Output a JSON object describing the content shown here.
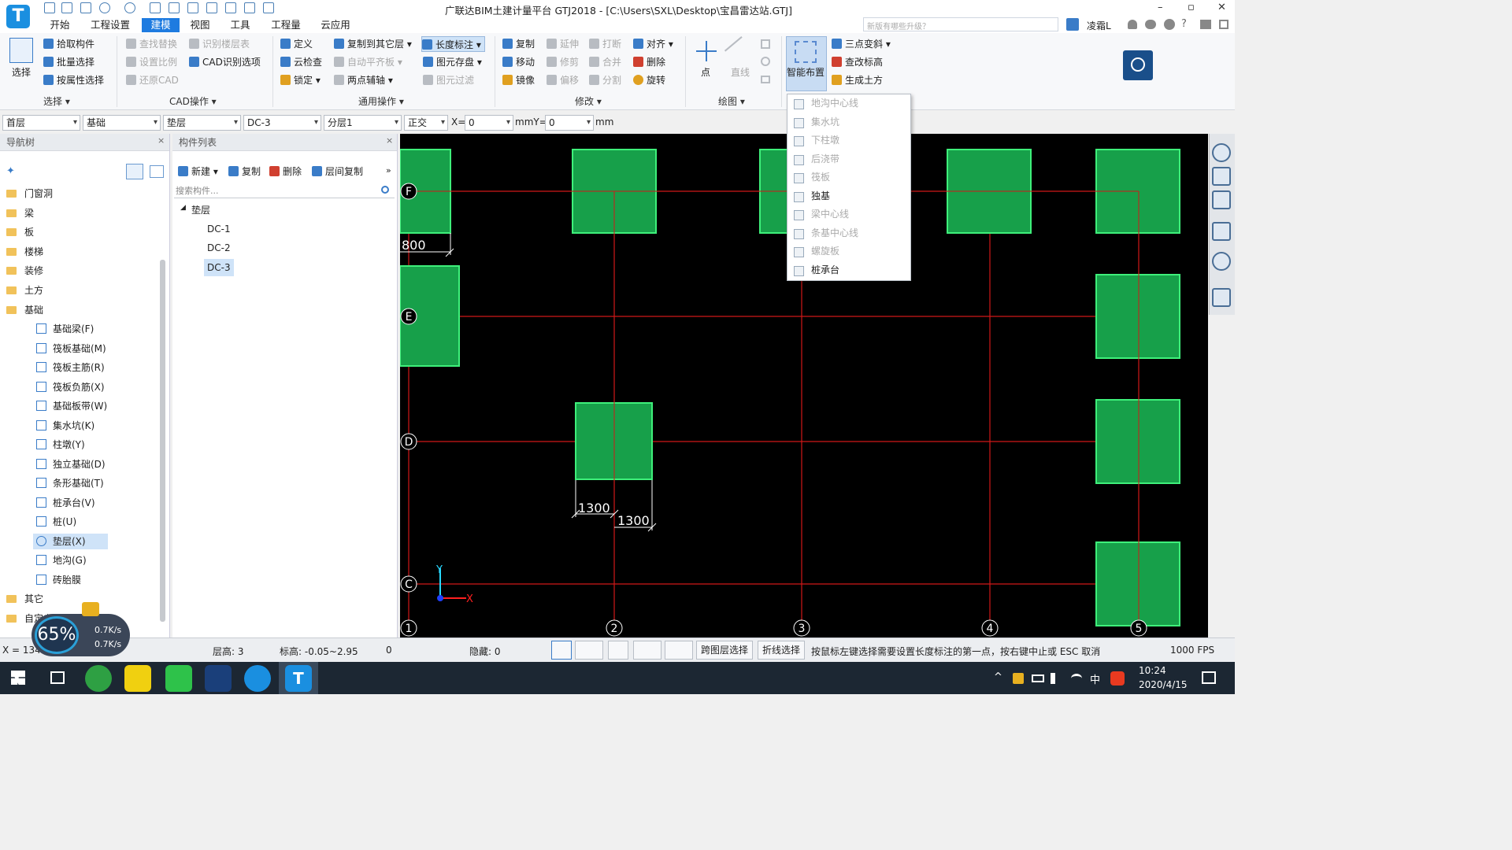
{
  "window": {
    "title": "广联达BIM土建计量平台 GTJ2018 - [C:\\Users\\SXL\\Desktop\\宝昌雷达站.GTJ]",
    "logo": "T",
    "controls": [
      "–",
      "▫",
      "✕"
    ]
  },
  "menu": {
    "tabs": [
      "开始",
      "工程设置",
      "建模",
      "视图",
      "工具",
      "工程量",
      "云应用"
    ],
    "active_tab": "建模",
    "search_placeholder": "新版有哪些升级？",
    "user_name": "凌霜L",
    "help": "?"
  },
  "ribbon": {
    "select": {
      "big_label": "选择",
      "items": [
        "拾取构件",
        "批量选择",
        "按属性选择"
      ],
      "group": "选择"
    },
    "cad": {
      "items": [
        "查找替换",
        "设置比例",
        "还原CAD",
        "识别楼层表",
        "CAD识别选项"
      ],
      "group": "CAD操作"
    },
    "common": {
      "items": [
        "定义",
        "云检查",
        "锁定",
        "复制到其它层",
        "自动平齐板",
        "两点辅轴",
        "长度标注",
        "图元存盘",
        "图元过滤"
      ],
      "group": "通用操作"
    },
    "modify": {
      "items": [
        "复制",
        "移动",
        "镜像",
        "延伸",
        "修剪",
        "偏移",
        "打断",
        "合并",
        "分割",
        "对齐",
        "删除",
        "旋转"
      ],
      "group": "修改"
    },
    "draw": {
      "items": [
        "点",
        "直线"
      ],
      "group": "绘图"
    },
    "smart": {
      "big_label": "智能布置",
      "items": [
        "三点变斜",
        "查改标高",
        "生成土方"
      ]
    }
  },
  "propbar": {
    "floor": "首层",
    "category": "基础",
    "type": "垫层",
    "component": "DC-3",
    "layer": "分层1",
    "mode": "正交",
    "x_label": "X=",
    "x_value": "0",
    "y_label": "mmY=",
    "y_value": "0",
    "unit": "mm"
  },
  "nav_tree": {
    "title": "导航树",
    "top_items": [
      "门窗洞",
      "梁",
      "板",
      "楼梯",
      "装修",
      "土方",
      "基础"
    ],
    "children": [
      "基础梁(F)",
      "筏板基础(M)",
      "筏板主筋(R)",
      "筏板负筋(X)",
      "基础板带(W)",
      "集水坑(K)",
      "柱墩(Y)",
      "独立基础(D)",
      "条形基础(T)",
      "桩承台(V)",
      "桩(U)",
      "垫层(X)",
      "地沟(G)",
      "砖胎膜"
    ],
    "selected": "垫层(X)",
    "bottom_items": [
      "其它",
      "自定义"
    ]
  },
  "comp_list": {
    "title": "构件列表",
    "toolbar": [
      "新建",
      "复制",
      "删除",
      "层间复制"
    ],
    "search_placeholder": "搜索构件...",
    "group": "垫层",
    "items": [
      "DC-1",
      "DC-2",
      "DC-3"
    ],
    "selected": "DC-3"
  },
  "dropdown": {
    "items": [
      {
        "label": "地沟中心线",
        "enabled": false
      },
      {
        "label": "集水坑",
        "enabled": false
      },
      {
        "label": "下柱墩",
        "enabled": false
      },
      {
        "label": "后浇带",
        "enabled": false
      },
      {
        "label": "筏板",
        "enabled": false
      },
      {
        "label": "独基",
        "enabled": true
      },
      {
        "label": "梁中心线",
        "enabled": false
      },
      {
        "label": "条基中心线",
        "enabled": false
      },
      {
        "label": "螺旋板",
        "enabled": false
      },
      {
        "label": "桩承台",
        "enabled": true
      }
    ]
  },
  "canvas": {
    "axis_rows": [
      "F",
      "E",
      "D",
      "C"
    ],
    "axis_cols": [
      "1",
      "2",
      "3",
      "4",
      "5"
    ],
    "dims": [
      "800",
      "1300",
      "1300"
    ],
    "colors": {
      "pad": "#17a04a",
      "pad_edge": "#3ef07a",
      "grid": "#d01818",
      "dim": "#ffffff"
    }
  },
  "statusbar": {
    "coord": "X = 134",
    "floor_height": "层高:   3",
    "elevation": "标高:   -0.05~2.95",
    "zero": "0",
    "hidden": "隐藏:   0",
    "btn_cross_floor": "跨图层选择",
    "btn_polyline": "折线选择",
    "hint": "按鼠标左键选择需要设置长度标注的第一点，按右键中止或 ESC 取消",
    "fps": "1000 FPS"
  },
  "speed_widget": {
    "percent": "65%",
    "up": "0.7K/s",
    "down": "0.7K/s"
  },
  "taskbar": {
    "time": "10:24",
    "date": "2020/4/15",
    "ime": "中",
    "tray": "^"
  }
}
